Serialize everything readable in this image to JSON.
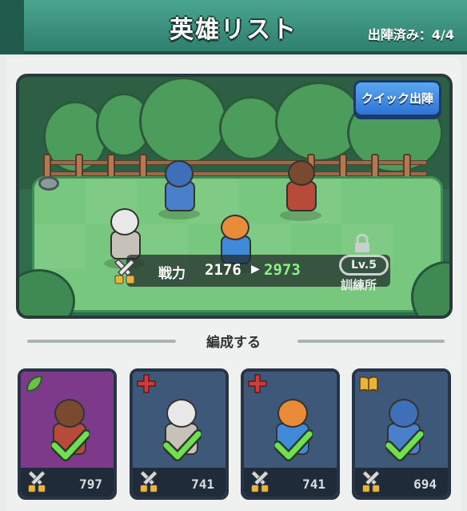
{
  "header": {
    "title": "英雄リスト",
    "deployed": "出陣済み：4/4"
  },
  "scene": {
    "quick_deploy_label": "クイック出陣",
    "power_label": "戦力",
    "power_current": "2176",
    "power_next": "2973",
    "facility_level": "Lv.5",
    "facility_name": "訓練所"
  },
  "formation_label": "編成する",
  "cards": [
    {
      "power": "797",
      "badge": "leaf-icon",
      "color": "#7d3a8a",
      "selected": true
    },
    {
      "power": "741",
      "badge": "red-cross-icon",
      "color": "#3d5878",
      "selected": true
    },
    {
      "power": "741",
      "badge": "red-cross-icon",
      "color": "#3d5878",
      "selected": true
    },
    {
      "power": "694",
      "badge": "book-icon",
      "color": "#3d5878",
      "selected": true
    }
  ],
  "colors": {
    "header": "#3f9a84",
    "field": "#78c77e",
    "quick_button": "#3f8ae3",
    "power_next": "#8ef08a"
  }
}
